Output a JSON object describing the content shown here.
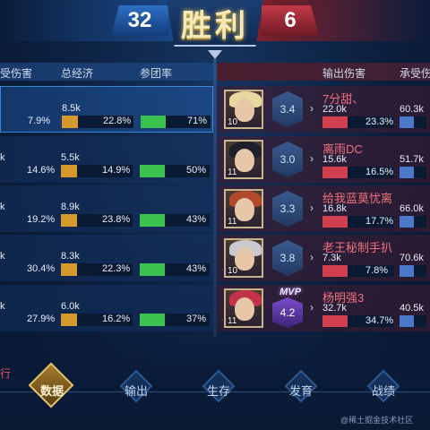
{
  "header": {
    "result_text": "胜利",
    "blue_score": "32",
    "red_score": "6"
  },
  "left_columns": {
    "damage_taken_partial": "受伤害",
    "gold": "总经济",
    "participation": "参团率"
  },
  "right_columns": {
    "damage_dealt": "输出伤害",
    "damage_taken": "承受伤"
  },
  "left_rows": [
    {
      "damage_partial": "",
      "damage_pct": "7.9%",
      "gold": "8.5k",
      "gold_pct": "22.8%",
      "gold_fill": 0.228,
      "kp": "71%",
      "kp_fill": 0.71,
      "highlight": true
    },
    {
      "damage_partial": "k",
      "damage_pct": "14.6%",
      "gold": "5.5k",
      "gold_pct": "14.9%",
      "gold_fill": 0.149,
      "kp": "50%",
      "kp_fill": 0.5,
      "highlight": false
    },
    {
      "damage_partial": "k",
      "damage_pct": "19.2%",
      "gold": "8.9k",
      "gold_pct": "23.8%",
      "gold_fill": 0.238,
      "kp": "43%",
      "kp_fill": 0.43,
      "highlight": false
    },
    {
      "damage_partial": "k",
      "damage_pct": "30.4%",
      "gold": "8.3k",
      "gold_pct": "22.3%",
      "gold_fill": 0.223,
      "kp": "43%",
      "kp_fill": 0.43,
      "highlight": false
    },
    {
      "damage_partial": "k",
      "damage_pct": "27.9%",
      "gold": "6.0k",
      "gold_pct": "16.2%",
      "gold_fill": 0.162,
      "kp": "37%",
      "kp_fill": 0.37,
      "highlight": false
    }
  ],
  "right_rows": [
    {
      "name": "7分甜、",
      "rating": "3.4",
      "level": "10",
      "dmg": "22.0k",
      "dmg_pct": "23.3%",
      "dmg_fill": 0.233,
      "taken": "60.3k",
      "mvp": false,
      "hair": "#e9d7a1"
    },
    {
      "name": "离雨DC",
      "rating": "3.0",
      "level": "11",
      "dmg": "15.6k",
      "dmg_pct": "16.5%",
      "dmg_fill": 0.165,
      "taken": "51.7k",
      "mvp": false,
      "hair": "#1e1f2a"
    },
    {
      "name": "给我蓝莫忧离",
      "rating": "3.3",
      "level": "11",
      "dmg": "16.8k",
      "dmg_pct": "17.7%",
      "dmg_fill": 0.177,
      "taken": "66.0k",
      "mvp": false,
      "hair": "#b3492c"
    },
    {
      "name": "老王秘制手扒",
      "rating": "3.8",
      "level": "10",
      "dmg": "7.3k",
      "dmg_pct": "7.8%",
      "dmg_fill": 0.078,
      "taken": "70.6k",
      "mvp": false,
      "hair": "#c9c9cf"
    },
    {
      "name": "杨明强3",
      "rating": "4.2",
      "level": "11",
      "dmg": "32.7k",
      "dmg_pct": "34.7%",
      "dmg_fill": 0.347,
      "taken": "40.5k",
      "mvp": true,
      "hair": "#c2334a"
    }
  ],
  "mvp_label": "MVP",
  "tabs": [
    {
      "label": "数据",
      "active": true
    },
    {
      "label": "输出",
      "active": false
    },
    {
      "label": "生存",
      "active": false
    },
    {
      "label": "发育",
      "active": false
    },
    {
      "label": "战绩",
      "active": false
    }
  ],
  "side_tag": "行",
  "watermark": "@稀土掘金技术社区",
  "colors": {
    "blue_team": "#2f6fc4",
    "red_team": "#c03a48",
    "gold_bar": "#d39a2b",
    "kp_bar": "#3cc24f",
    "dmg_bar": "#d2404f",
    "taken_bar": "#4a79c9",
    "mvp": "#7b4bc9"
  }
}
